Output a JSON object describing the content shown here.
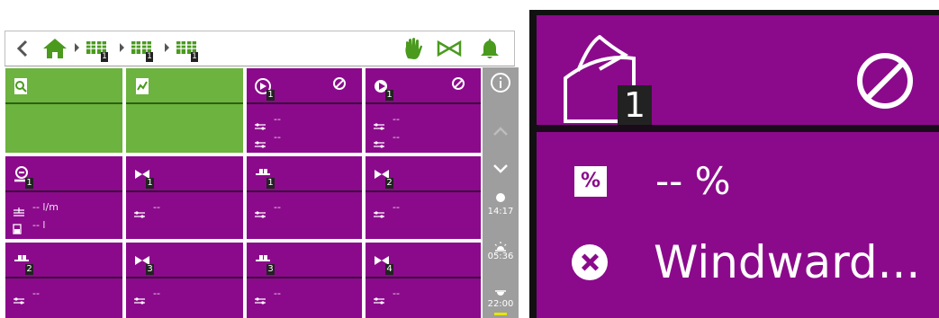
{
  "colors": {
    "accent_green": "#6cb33f",
    "tile_purple": "#8b0a8b",
    "sidebar_gray": "#9e9e9e",
    "divider_dark": "#3a0b3a"
  },
  "topbar": {
    "breadcrumb_badges": [
      "1",
      "1",
      "1"
    ],
    "icons": [
      "back-chevron-icon",
      "home-icon",
      "zone-icon",
      "zone-icon",
      "zone-icon",
      "hand-icon",
      "valve-icon",
      "bell-icon"
    ]
  },
  "tiles": [
    {
      "id": "search",
      "color": "green",
      "icon": "search-doc-icon"
    },
    {
      "id": "report",
      "color": "green",
      "icon": "chart-doc-icon"
    },
    {
      "id": "vent1",
      "color": "purple",
      "icon": "vent-icon",
      "number": "1",
      "blocked": true,
      "rows": [
        "--",
        "--"
      ]
    },
    {
      "id": "vent2",
      "color": "purple",
      "icon": "vent-play-icon",
      "number": "1",
      "blocked": true,
      "rows": [
        "--",
        "--"
      ]
    },
    {
      "id": "meter1",
      "color": "purple",
      "icon": "flow-meter-icon",
      "number": "1",
      "rows": [
        "-- l/m",
        "-- l"
      ]
    },
    {
      "id": "valve1",
      "color": "purple",
      "icon": "valve-icon",
      "number": "1",
      "rows": [
        "--"
      ]
    },
    {
      "id": "pump1",
      "color": "purple",
      "icon": "pump-icon",
      "number": "1",
      "rows": [
        "--"
      ]
    },
    {
      "id": "valve2",
      "color": "purple",
      "icon": "valve-icon",
      "number": "2",
      "rows": [
        "--"
      ]
    },
    {
      "id": "pump2",
      "color": "purple",
      "icon": "pump-icon",
      "number": "2",
      "rows": [
        "--"
      ]
    },
    {
      "id": "valve3",
      "color": "purple",
      "icon": "valve-icon",
      "number": "3",
      "rows": [
        "--"
      ]
    },
    {
      "id": "pump3",
      "color": "purple",
      "icon": "pump-icon",
      "number": "3",
      "rows": [
        "--"
      ]
    },
    {
      "id": "valve4",
      "color": "purple",
      "icon": "valve-icon",
      "number": "4",
      "rows": [
        "--"
      ]
    }
  ],
  "sidebar": {
    "time_now": "14:17",
    "sunrise": "05:36",
    "sunset": "22:00"
  },
  "zoom_tile": {
    "number": "1",
    "value": "-- %",
    "unit_badge": "%",
    "status": "Windward..."
  }
}
